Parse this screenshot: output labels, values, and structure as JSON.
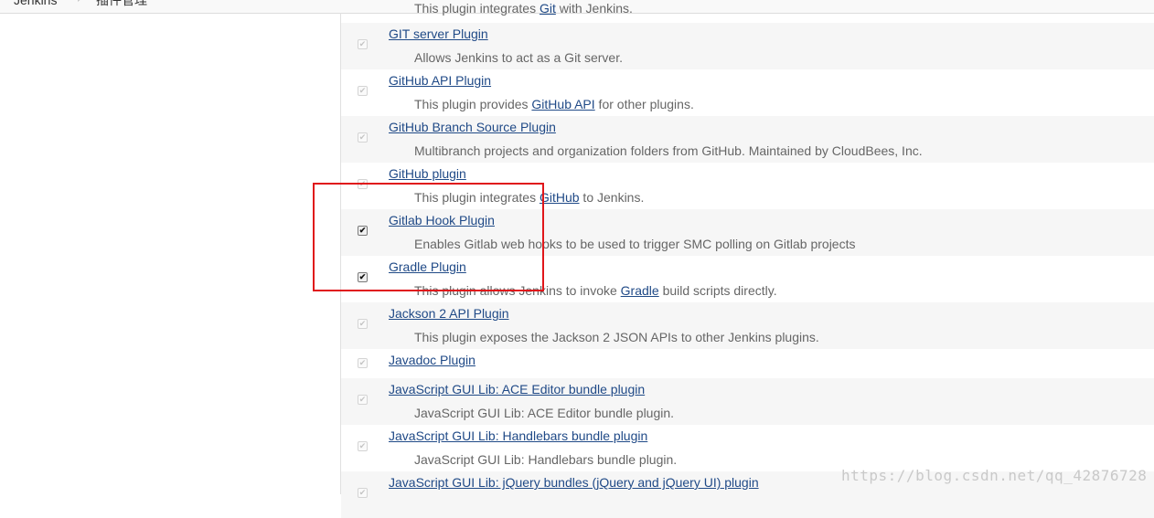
{
  "breadcrumb": {
    "root": "Jenkins",
    "current": "插件管理"
  },
  "plugins": {
    "top_desc": {
      "pre": "This plugin integrates ",
      "link": "Git",
      "post": " with Jenkins."
    },
    "items": [
      {
        "name": "GIT server Plugin",
        "desc_pre": "Allows Jenkins to act as a Git server.",
        "desc_link": "",
        "desc_post": "",
        "checked": true,
        "enabled": false
      },
      {
        "name": "GitHub API Plugin",
        "desc_pre": "This plugin provides ",
        "desc_link": "GitHub API",
        "desc_post": " for other plugins.",
        "checked": true,
        "enabled": false
      },
      {
        "name": "GitHub Branch Source Plugin",
        "desc_pre": "Multibranch projects and organization folders from GitHub. Maintained by CloudBees, Inc.",
        "desc_link": "",
        "desc_post": "",
        "checked": true,
        "enabled": false
      },
      {
        "name": "GitHub plugin",
        "desc_pre": "This plugin integrates ",
        "desc_link": "GitHub",
        "desc_post": " to Jenkins.",
        "checked": true,
        "enabled": false
      },
      {
        "name": "Gitlab Hook Plugin",
        "desc_pre": "Enables Gitlab web hooks to be used to trigger SMC polling on Gitlab projects",
        "desc_link": "",
        "desc_post": "",
        "checked": true,
        "enabled": true
      },
      {
        "name": "Gradle Plugin",
        "desc_pre": "This plugin allows Jenkins to invoke ",
        "desc_link": "Gradle",
        "desc_post": " build scripts directly.",
        "checked": true,
        "enabled": true
      },
      {
        "name": "Jackson 2 API Plugin",
        "desc_pre": "This plugin exposes the Jackson 2 JSON APIs to other Jenkins plugins.",
        "desc_link": "",
        "desc_post": "",
        "checked": true,
        "enabled": false
      },
      {
        "name": "Javadoc Plugin",
        "desc_pre": "",
        "desc_link": "",
        "desc_post": "",
        "checked": true,
        "enabled": false
      },
      {
        "name": "JavaScript GUI Lib: ACE Editor bundle plugin",
        "desc_pre": "JavaScript GUI Lib: ACE Editor bundle plugin.",
        "desc_link": "",
        "desc_post": "",
        "checked": true,
        "enabled": false
      },
      {
        "name": "JavaScript GUI Lib: Handlebars bundle plugin",
        "desc_pre": "JavaScript GUI Lib: Handlebars bundle plugin.",
        "desc_link": "",
        "desc_post": "",
        "checked": true,
        "enabled": false
      },
      {
        "name": "JavaScript GUI Lib: jQuery bundles (jQuery and jQuery UI) plugin",
        "desc_pre": "",
        "desc_link": "",
        "desc_post": "",
        "checked": true,
        "enabled": false
      }
    ]
  },
  "watermark": "https://blog.csdn.net/qq_42876728",
  "colors": {
    "link": "#204a87",
    "highlight": "#e0161a",
    "row_alt": "#f6f6f6"
  }
}
